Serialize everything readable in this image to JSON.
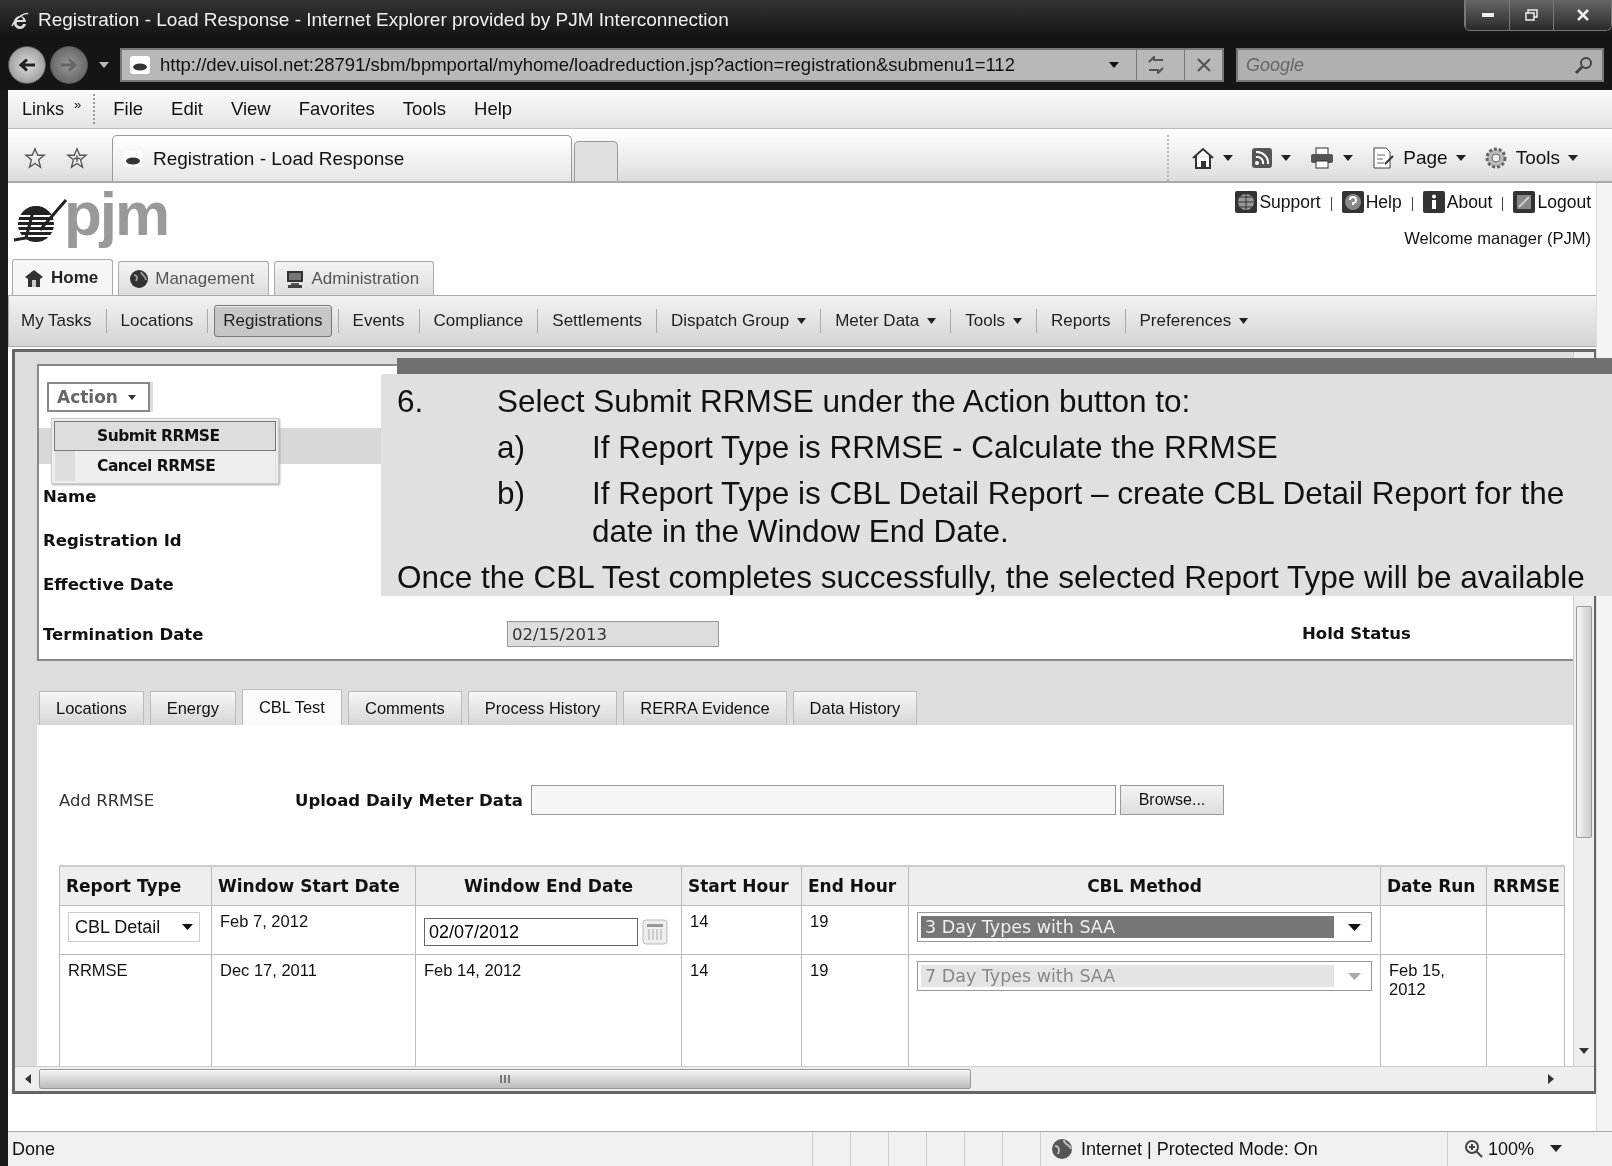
{
  "window": {
    "title": "Registration - Load Response - Internet Explorer provided by PJM Interconnection"
  },
  "address_bar": {
    "url": "http://dev.uisol.net:28791/sbm/bpmportal/myhome/loadreduction.jsp?action=registration&submenu1=112"
  },
  "search": {
    "placeholder": "Google"
  },
  "links": {
    "label": "Links",
    "chevron": "»"
  },
  "menu": [
    "File",
    "Edit",
    "View",
    "Favorites",
    "Tools",
    "Help"
  ],
  "browser_tab": {
    "title": "Registration - Load Response"
  },
  "command_bar": [
    {
      "kind": "home"
    },
    {
      "kind": "feed"
    },
    {
      "kind": "print"
    },
    {
      "kind": "page",
      "label": "Page"
    },
    {
      "kind": "tools",
      "label": "Tools"
    }
  ],
  "logo": {
    "text": "pjm"
  },
  "header_links": [
    {
      "kind": "support",
      "label": "Support"
    },
    {
      "kind": "help",
      "label": "Help"
    },
    {
      "kind": "about",
      "label": "About"
    },
    {
      "kind": "logout",
      "label": "Logout"
    }
  ],
  "welcome": "Welcome manager (PJM)",
  "main_tabs": [
    {
      "kind": "home",
      "label": "Home",
      "selected": true
    },
    {
      "kind": "management",
      "label": "Management",
      "selected": false
    },
    {
      "kind": "administration",
      "label": "Administration",
      "selected": false
    }
  ],
  "nav": [
    {
      "label": "My Tasks",
      "selected": false,
      "dropdown": false
    },
    {
      "label": "Locations",
      "selected": false,
      "dropdown": false
    },
    {
      "label": "Registrations",
      "selected": true,
      "dropdown": false
    },
    {
      "label": "Events",
      "selected": false,
      "dropdown": false
    },
    {
      "label": "Compliance",
      "selected": false,
      "dropdown": false
    },
    {
      "label": "Settlements",
      "selected": false,
      "dropdown": false
    },
    {
      "label": "Dispatch Group",
      "selected": false,
      "dropdown": true
    },
    {
      "label": "Meter Data",
      "selected": false,
      "dropdown": true
    },
    {
      "label": "Tools",
      "selected": false,
      "dropdown": true
    },
    {
      "label": "Reports",
      "selected": false,
      "dropdown": false
    },
    {
      "label": "Preferences",
      "selected": false,
      "dropdown": true
    }
  ],
  "action_button": "Action",
  "action_menu": [
    {
      "label": "Submit RRMSE",
      "selected": true
    },
    {
      "label": "Cancel RRMSE",
      "selected": false
    }
  ],
  "fields": [
    {
      "label": "Name"
    },
    {
      "label": "Registration Id"
    },
    {
      "label": "Effective Date"
    },
    {
      "label": "Termination Date",
      "value": "02/15/2013"
    }
  ],
  "hold_status_label": "Hold Status",
  "detail_tabs": [
    {
      "label": "Locations",
      "selected": false
    },
    {
      "label": "Energy",
      "selected": false
    },
    {
      "label": "CBL Test",
      "selected": true
    },
    {
      "label": "Comments",
      "selected": false
    },
    {
      "label": "Process History",
      "selected": false
    },
    {
      "label": "RERRA Evidence",
      "selected": false
    },
    {
      "label": "Data History",
      "selected": false
    }
  ],
  "add_rrmse": "Add RRMSE",
  "upload": {
    "label": "Upload Daily Meter Data",
    "button": "Browse..."
  },
  "table": {
    "columns": [
      "Report Type",
      "Window Start Date",
      "Window End Date",
      "Start Hour",
      "End Hour",
      "CBL Method",
      "Date Run",
      "RRMSE"
    ],
    "rows": [
      {
        "kind": "editable",
        "report_type": "CBL Detail",
        "window_start": "Feb 7, 2012",
        "window_end": "02/07/2012",
        "start_hour": "14",
        "end_hour": "19",
        "cbl_method": "3 Day Types with SAA"
      },
      {
        "kind": "readonly",
        "report_type": "RRMSE",
        "window_start": "Dec 17, 2011",
        "window_end": "Feb 14, 2012",
        "start_hour": "14",
        "end_hour": "19",
        "cbl_method": "7 Day Types with SAA",
        "date_run": "Feb 15, 2012"
      }
    ]
  },
  "callout": {
    "number": "6.",
    "lead": "Select Submit RRMSE under the Action button to:",
    "items": [
      {
        "marker": "a)",
        "text": "If Report Type is RRMSE - Calculate the RRMSE"
      },
      {
        "marker": "b)",
        "text": "If Report Type is CBL Detail Report – create CBL Detail Report for the date in the Window End Date."
      }
    ],
    "footer": "Once the CBL Test completes successfully, the selected Report Type will be available"
  },
  "status_bar": {
    "text": "Done",
    "zone": "Internet | Protected Mode: On",
    "zoom": "100%"
  }
}
